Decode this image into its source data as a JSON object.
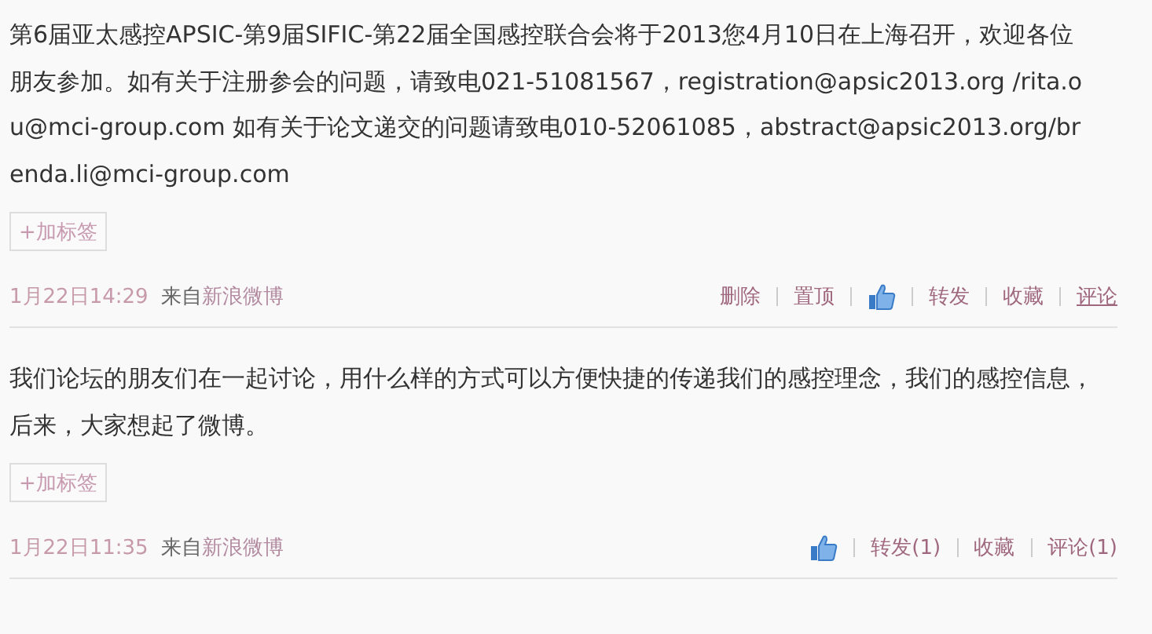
{
  "posts": [
    {
      "text": "第6届亚太感控APSIC-第9届SIFIC-第22届全国感控联合会将于2013您4月10日在上海召开，欢迎各位朋友参加。如有关于注册参会的问题，请致电021-51081567，registration@apsic2013.org /rita.ou@mci-group.com 如有关于论文递交的问题请致电010-52061085，abstract@apsic2013.org/brenda.li@mci-group.com",
      "tag_button": "+加标签",
      "time": "1月22日14:29",
      "source_prefix": "来自",
      "source": "新浪微博",
      "actions": [
        {
          "kind": "text",
          "label": "删除",
          "underlined": false
        },
        {
          "kind": "text",
          "label": "置顶",
          "underlined": false
        },
        {
          "kind": "like"
        },
        {
          "kind": "text",
          "label": "转发",
          "underlined": false
        },
        {
          "kind": "text",
          "label": "收藏",
          "underlined": false
        },
        {
          "kind": "text",
          "label": "评论",
          "underlined": true
        }
      ]
    },
    {
      "text": "我们论坛的朋友们在一起讨论，用什么样的方式可以方便快捷的传递我们的感控理念，我们的感控信息，后来，大家想起了微博。",
      "tag_button": "+加标签",
      "time": "1月22日11:35",
      "source_prefix": "来自",
      "source": "新浪微博",
      "actions": [
        {
          "kind": "like"
        },
        {
          "kind": "text",
          "label": "转发(1)",
          "underlined": false
        },
        {
          "kind": "text",
          "label": "收藏",
          "underlined": false
        },
        {
          "kind": "text",
          "label": "评论(1)",
          "underlined": false
        }
      ]
    }
  ]
}
